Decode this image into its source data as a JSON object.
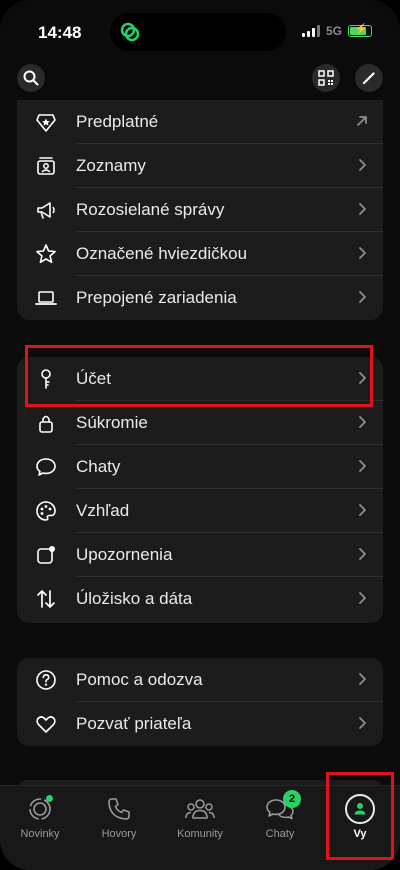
{
  "status": {
    "time": "14:48",
    "network": "5G"
  },
  "colors": {
    "accent": "#25d366",
    "highlight": "#e0121b",
    "card": "#1c1c1c"
  },
  "topbar": {
    "search_icon": "search-icon",
    "qr_icon": "qr-icon",
    "edit_icon": "pencil-icon"
  },
  "sections": [
    {
      "items": [
        {
          "label": "Predplatné",
          "icon": "badge-star-icon",
          "trailing": "arrow-up-right-icon"
        },
        {
          "label": "Zoznamy",
          "icon": "list-contacts-icon",
          "trailing": "chevron-right-icon"
        },
        {
          "label": "Rozosielané správy",
          "icon": "megaphone-icon",
          "trailing": "chevron-right-icon"
        },
        {
          "label": "Označené hviezdičkou",
          "icon": "star-icon",
          "trailing": "chevron-right-icon"
        },
        {
          "label": "Prepojené zariadenia",
          "icon": "laptop-icon",
          "trailing": "chevron-right-icon"
        }
      ]
    },
    {
      "items": [
        {
          "label": "Účet",
          "icon": "key-icon",
          "trailing": "chevron-right-icon"
        },
        {
          "label": "Súkromie",
          "icon": "lock-icon",
          "trailing": "chevron-right-icon"
        },
        {
          "label": "Chaty",
          "icon": "chat-bubble-icon",
          "trailing": "chevron-right-icon"
        },
        {
          "label": "Vzhľad",
          "icon": "palette-icon",
          "trailing": "chevron-right-icon"
        },
        {
          "label": "Upozornenia",
          "icon": "notification-icon",
          "trailing": "chevron-right-icon"
        },
        {
          "label": "Úložisko a dáta",
          "icon": "arrows-updown-icon",
          "trailing": "chevron-right-icon"
        }
      ]
    },
    {
      "items": [
        {
          "label": "Pomoc a odozva",
          "icon": "help-circle-icon",
          "trailing": "chevron-right-icon"
        },
        {
          "label": "Pozvať priateľa",
          "icon": "heart-icon",
          "trailing": "chevron-right-icon"
        }
      ]
    }
  ],
  "tabs": [
    {
      "label": "Novinky",
      "icon": "status-icon"
    },
    {
      "label": "Hovory",
      "icon": "phone-icon"
    },
    {
      "label": "Komunity",
      "icon": "community-icon"
    },
    {
      "label": "Chaty",
      "icon": "chats-icon",
      "badge": "2"
    },
    {
      "label": "Vy",
      "icon": "profile-icon",
      "active": true
    }
  ]
}
